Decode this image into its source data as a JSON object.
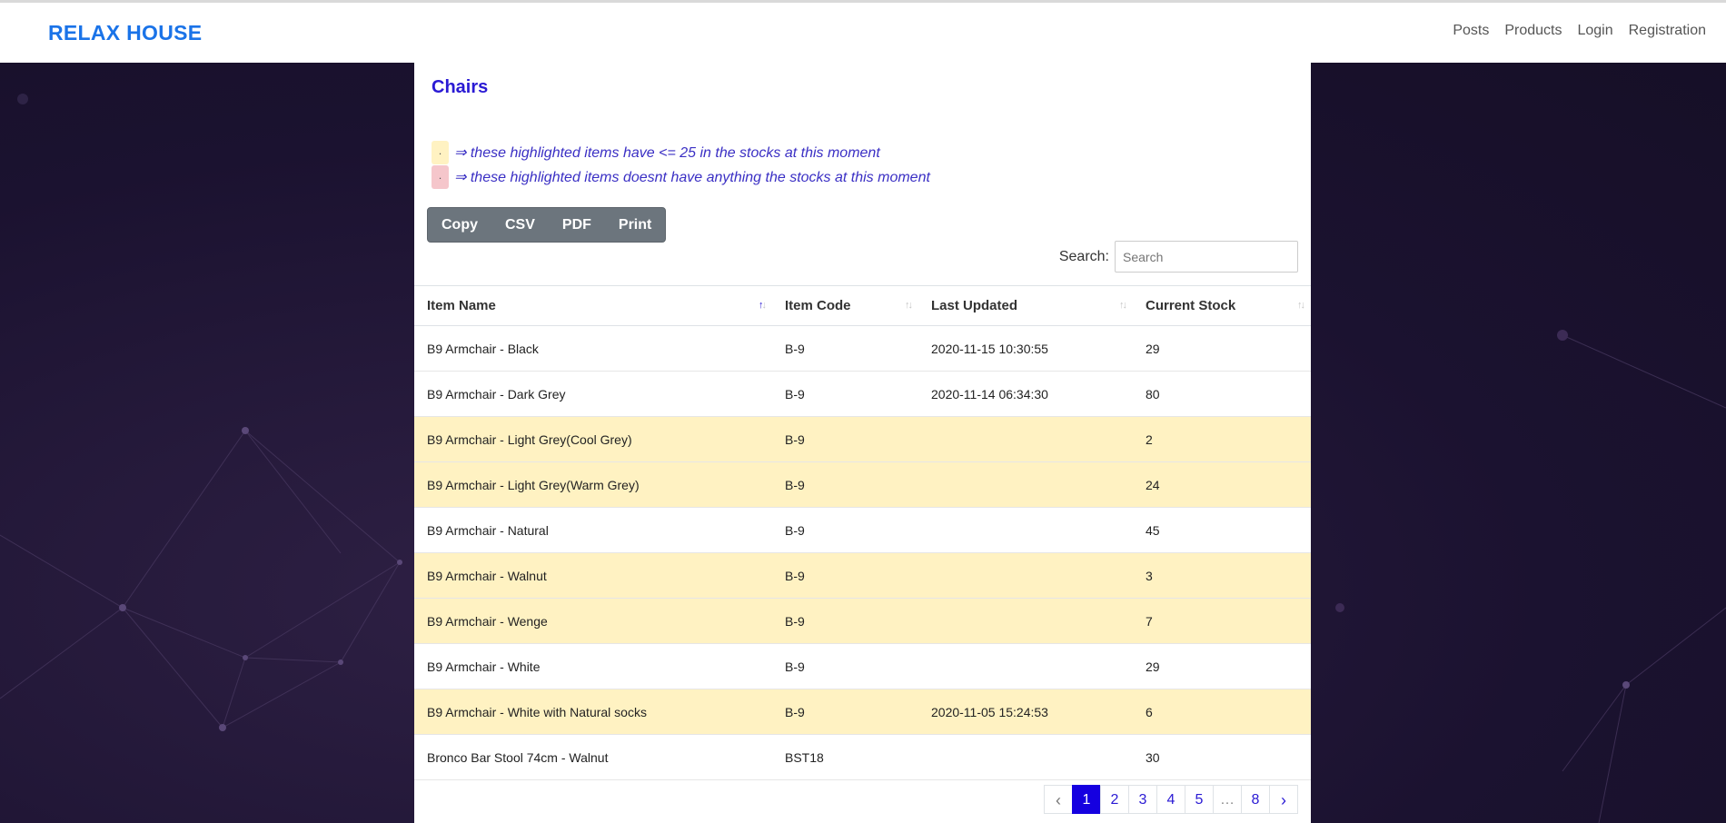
{
  "header": {
    "brand": "RELAX HOUSE",
    "nav": [
      "Posts",
      "Products",
      "Login",
      "Registration"
    ]
  },
  "page": {
    "title": "Chairs",
    "legend": [
      {
        "swatch": ".",
        "text": "⇒ these highlighted items have <= 25 in the stocks at this moment",
        "color": "#fff2c2"
      },
      {
        "swatch": ".",
        "text": "⇒ these highlighted items doesnt have anything the stocks at this moment",
        "color": "#f5c6cb"
      }
    ],
    "export_buttons": [
      "Copy",
      "CSV",
      "PDF",
      "Print"
    ],
    "search": {
      "label": "Search:",
      "placeholder": "Search",
      "value": ""
    }
  },
  "table": {
    "columns": [
      "Item Name",
      "Item Code",
      "Last Updated",
      "Current Stock"
    ],
    "rows": [
      {
        "name": "B9 Armchair - Black",
        "code": "B-9",
        "updated": "2020-11-15 10:30:55",
        "stock": "29",
        "highlight": false
      },
      {
        "name": "B9 Armchair - Dark Grey",
        "code": "B-9",
        "updated": "2020-11-14 06:34:30",
        "stock": "80",
        "highlight": false
      },
      {
        "name": "B9 Armchair - Light Grey(Cool Grey)",
        "code": "B-9",
        "updated": "",
        "stock": "2",
        "highlight": true
      },
      {
        "name": "B9 Armchair - Light Grey(Warm Grey)",
        "code": "B-9",
        "updated": "",
        "stock": "24",
        "highlight": true
      },
      {
        "name": "B9 Armchair - Natural",
        "code": "B-9",
        "updated": "",
        "stock": "45",
        "highlight": false
      },
      {
        "name": "B9 Armchair - Walnut",
        "code": "B-9",
        "updated": "",
        "stock": "3",
        "highlight": true
      },
      {
        "name": "B9 Armchair - Wenge",
        "code": "B-9",
        "updated": "",
        "stock": "7",
        "highlight": true
      },
      {
        "name": "B9 Armchair - White",
        "code": "B-9",
        "updated": "",
        "stock": "29",
        "highlight": false
      },
      {
        "name": "B9 Armchair - White with Natural socks",
        "code": "B-9",
        "updated": "2020-11-05 15:24:53",
        "stock": "6",
        "highlight": true
      },
      {
        "name": "Bronco Bar Stool 74cm - Walnut",
        "code": "BST18",
        "updated": "",
        "stock": "30",
        "highlight": false
      }
    ]
  },
  "pagination": {
    "pages": [
      "1",
      "2",
      "3",
      "4",
      "5",
      "…",
      "8"
    ],
    "active": "1",
    "prev_icon": "chevron-left-icon",
    "next_icon": "chevron-right-icon"
  },
  "colors": {
    "accent": "#2a1ad4",
    "brand": "#1a73e8",
    "highlight_low": "#fff2c2",
    "highlight_empty": "#f5c6cb"
  }
}
